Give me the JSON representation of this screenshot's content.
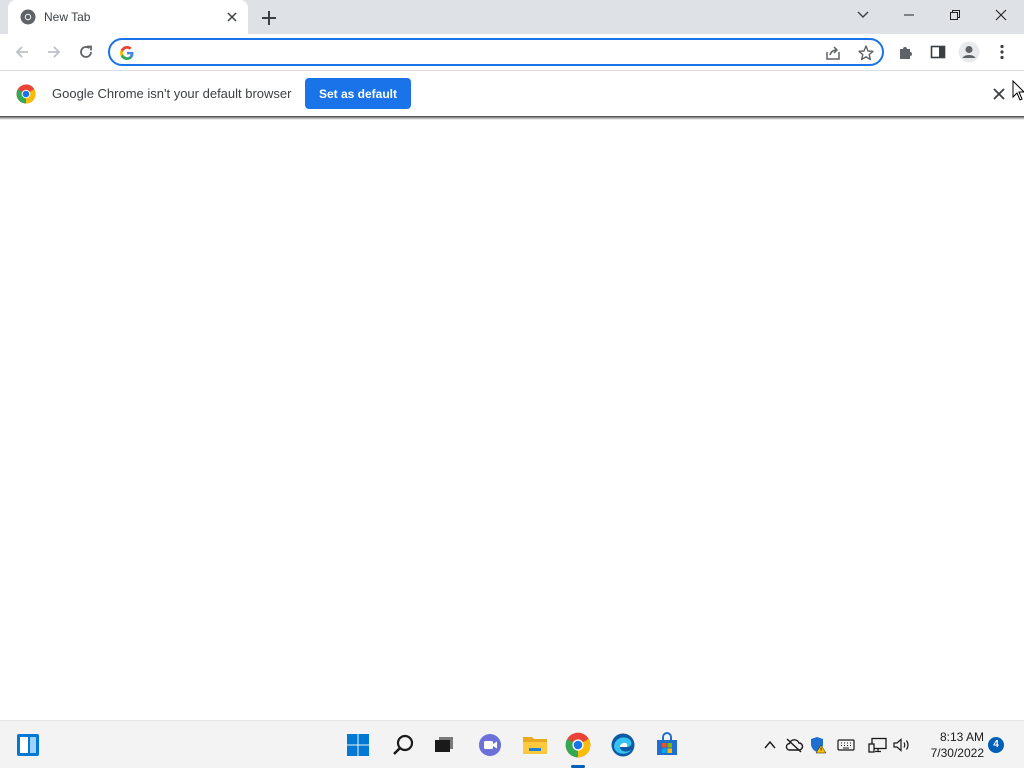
{
  "browser": {
    "tab": {
      "title": "New Tab"
    },
    "omnibox": {
      "value": "",
      "placeholder": ""
    },
    "infobar": {
      "message": "Google Chrome isn't your default browser",
      "button_label": "Set as default"
    }
  },
  "taskbar": {
    "clock": {
      "time": "8:13 AM",
      "date": "7/30/2022"
    },
    "notifications_count": "4"
  },
  "colors": {
    "accent": "#1a73e8",
    "tabstrip": "#dee1e6",
    "taskbar": "#f3f3f3",
    "windows_blue": "#005fb8"
  }
}
